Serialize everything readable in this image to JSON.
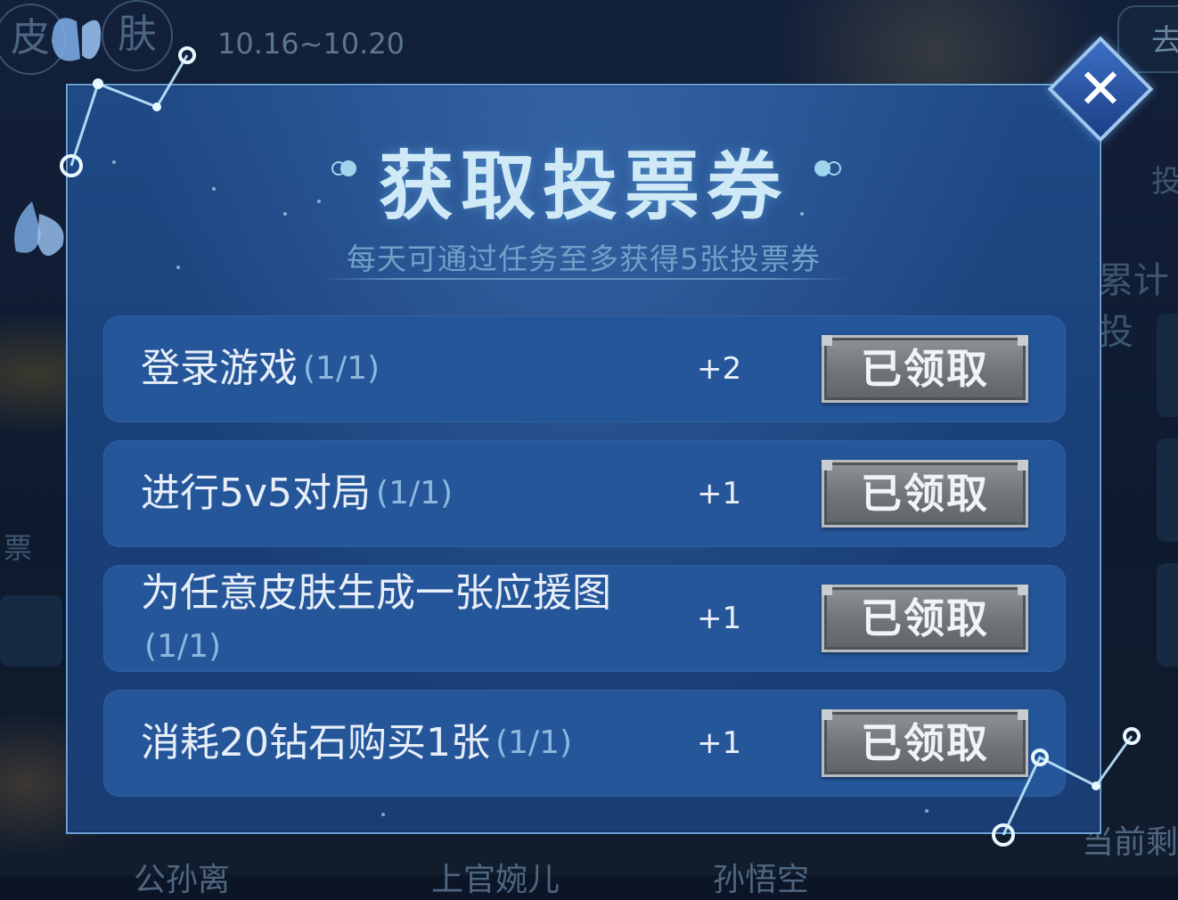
{
  "background": {
    "date_range": "10.16~10.20",
    "left_pills": [
      "皮",
      "肤"
    ],
    "right_button_label": "去",
    "side_text_1": "投",
    "side_text_2": "累计投",
    "left_label": "票",
    "bottom_right_text": "当前剩",
    "bottom_names": [
      "公孙离",
      "上官婉儿",
      "孙悟空"
    ]
  },
  "dialog": {
    "title": "获取投票券",
    "subtitle": "每天可通过任务至多获得5张投票券",
    "tasks": [
      {
        "name": "登录游戏",
        "progress": "(1/1)",
        "points": "+2",
        "button": "已领取"
      },
      {
        "name": "进行5v5对局",
        "progress": "(1/1)",
        "points": "+1",
        "button": "已领取"
      },
      {
        "name": "为任意皮肤生成一张应援图",
        "progress": "(1/1)",
        "points": "+1",
        "button": "已领取"
      },
      {
        "name": "消耗20钻石购买1张",
        "progress": "(1/1)",
        "points": "+1",
        "button": "已领取"
      }
    ],
    "close_glyph": "✕"
  },
  "icons": {
    "close": "close-icon",
    "butterfly": "butterfly-icon",
    "constellation": "constellation-icon"
  },
  "colors": {
    "dialog_bg": "#1f4a86",
    "row_bg": "#25569a",
    "title": "#cfe9f6",
    "claimed_button": "#7a7f84"
  }
}
